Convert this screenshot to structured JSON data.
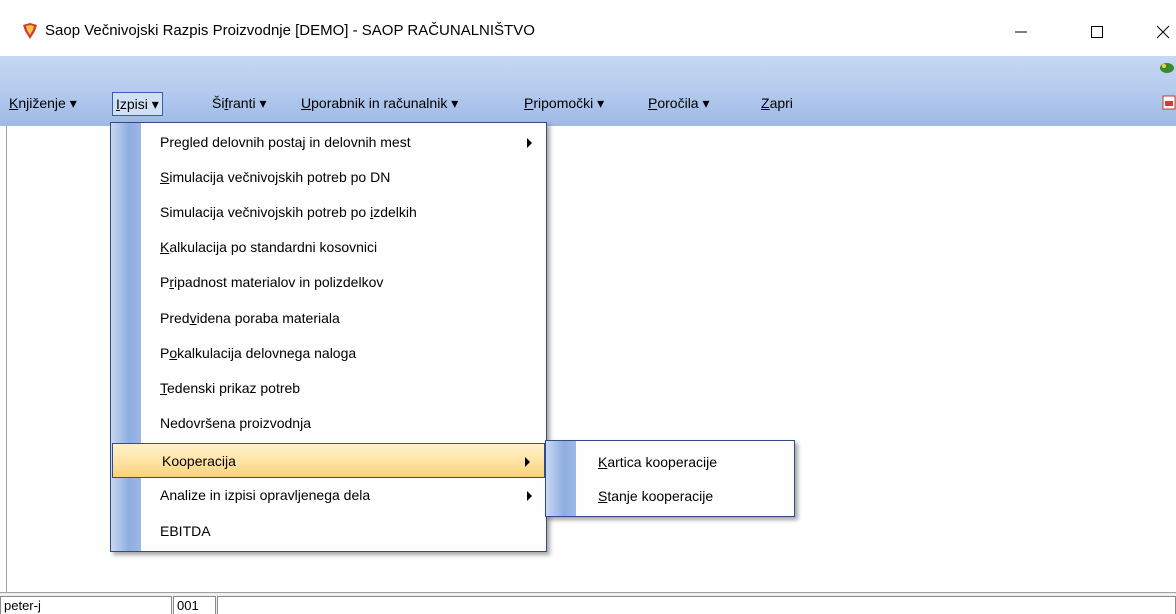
{
  "window": {
    "title": "Saop  Večnivojski Razpis Proizvodnje [DEMO] - SAOP RAČUNALNIŠTVO",
    "minimize_glyph": "—",
    "maximize_glyph": "☐",
    "close_glyph": "✕"
  },
  "menubar": {
    "items": [
      {
        "pre": "",
        "ul": "K",
        "post": "njiženje ▾"
      },
      {
        "pre": "",
        "ul": "I",
        "post": "zpisi ▾"
      },
      {
        "pre": "Ši",
        "ul": "f",
        "post": "ranti ▾"
      },
      {
        "pre": "",
        "ul": "U",
        "post": "porabnik in računalnik ▾"
      },
      {
        "pre": "",
        "ul": "P",
        "post": "ripomočki ▾"
      },
      {
        "pre": "",
        "ul": "P",
        "post": "oročila ▾"
      },
      {
        "pre": "",
        "ul": "Z",
        "post": "apri"
      }
    ]
  },
  "dropdown": {
    "items": [
      {
        "pre": "Pregled delovnih postaj in delovnih mest",
        "ul": "",
        "post": "",
        "submenu": true
      },
      {
        "pre": "",
        "ul": "S",
        "post": "imulacija večnivojskih potreb po DN",
        "submenu": false
      },
      {
        "pre": "Simulacija večnivojskih potreb po ",
        "ul": "i",
        "post": "zdelkih",
        "submenu": false
      },
      {
        "pre": "",
        "ul": "K",
        "post": "alkulacija po standardni kosovnici",
        "submenu": false
      },
      {
        "pre": "P",
        "ul": "r",
        "post": "ipadnost materialov in polizdelkov",
        "submenu": false
      },
      {
        "pre": "Pred",
        "ul": "v",
        "post": "idena poraba materiala",
        "submenu": false
      },
      {
        "pre": "P",
        "ul": "o",
        "post": "kalkulacija delovnega naloga",
        "submenu": false
      },
      {
        "pre": "",
        "ul": "T",
        "post": "edenski prikaz potreb",
        "submenu": false
      },
      {
        "pre": "Nedovršena proizvodnja",
        "ul": "",
        "post": "",
        "submenu": false
      },
      {
        "pre": "Kooperacija",
        "ul": "",
        "post": "",
        "submenu": true
      },
      {
        "pre": "Analize in izpisi opravljenega dela",
        "ul": "",
        "post": "",
        "submenu": true
      },
      {
        "pre": "EBITDA",
        "ul": "",
        "post": "",
        "submenu": false
      }
    ]
  },
  "submenu": {
    "items": [
      {
        "pre": "",
        "ul": "K",
        "post": "artica kooperacije"
      },
      {
        "pre": "",
        "ul": "S",
        "post": "tanje kooperacije"
      }
    ]
  },
  "statusbar": {
    "user": "peter-j",
    "code": "001",
    "message": ""
  }
}
